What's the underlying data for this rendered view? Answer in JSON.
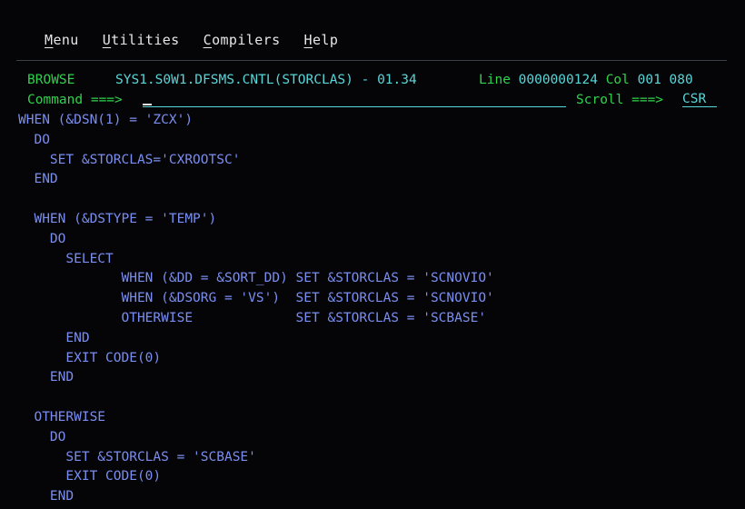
{
  "menu": [
    {
      "hot": "M",
      "rest": "enu"
    },
    {
      "hot": "U",
      "rest": "tilities"
    },
    {
      "hot": "C",
      "rest": "ompilers"
    },
    {
      "hot": "H",
      "rest": "elp"
    }
  ],
  "header": {
    "mode": "BROWSE",
    "dataset": "SYS1.S0W1.DFSMS.CNTL(STORCLAS) - 01.34",
    "line_label": "Line",
    "line_value": "0000000124",
    "col_label": "Col",
    "col_value": "001 080"
  },
  "command": {
    "label": "Command ===>",
    "value": ""
  },
  "scroll": {
    "label": "Scroll ===>",
    "value": "CSR"
  },
  "code_lines": [
    "WHEN (&DSN(1) = 'ZCX')",
    "  DO",
    "    SET &STORCLAS='CXROOTSC'",
    "  END",
    "",
    "  WHEN (&DSTYPE = 'TEMP')",
    "    DO",
    "      SELECT",
    "             WHEN (&DD = &SORT_DD) SET &STORCLAS = 'SCNOVIO'",
    "             WHEN (&DSORG = 'VS')  SET &STORCLAS = 'SCNOVIO'",
    "             OTHERWISE             SET &STORCLAS = 'SCBASE'",
    "      END",
    "      EXIT CODE(0)",
    "    END",
    "",
    "  OTHERWISE",
    "    DO",
    "      SET &STORCLAS = 'SCBASE'",
    "      EXIT CODE(0)",
    "    END"
  ]
}
